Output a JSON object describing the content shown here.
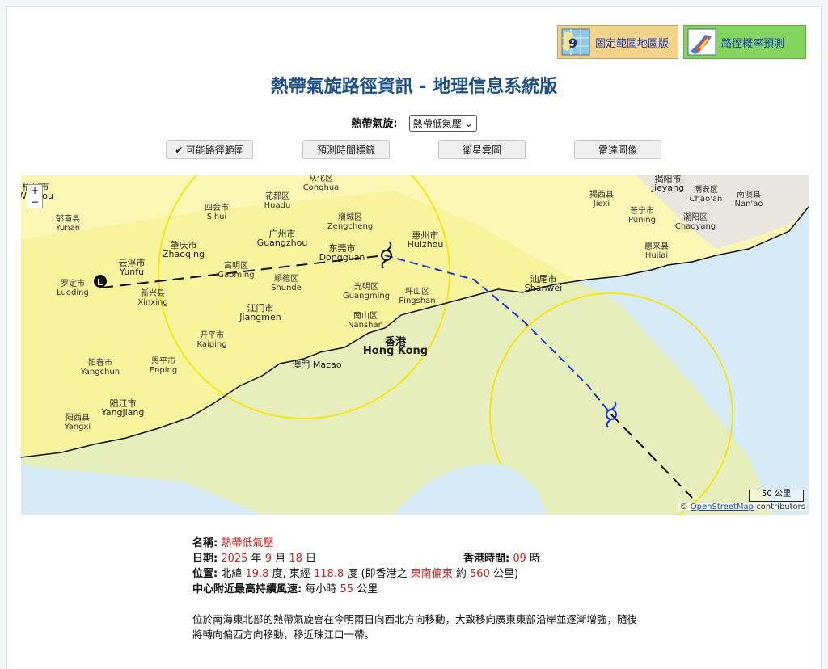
{
  "header": {
    "fixed_map_label": "固定範圍地圖版",
    "prob_label": "路徑概率預測",
    "title": "熱帶氣旋路徑資訊 - 地理信息系統版"
  },
  "selector": {
    "label": "熱帶氣旋:",
    "value": "熱帶低氣壓"
  },
  "controls": {
    "range": "✔ 可能路徑範圍",
    "time_labels": "預測時間標籤",
    "satellite": "衛星雲圖",
    "radar": "雷達圖像"
  },
  "map": {
    "attribution_symbol": "©",
    "attribution_link": "OpenStreetMap",
    "attribution_tail": "contributors",
    "scale": "50 公里",
    "zoom_in": "+",
    "zoom_out": "−",
    "places": [
      {
        "zh": "梧州市",
        "en": "Wuzhou"
      },
      {
        "zh": "从化区",
        "en": "Conghua"
      },
      {
        "zh": "揭阳市",
        "en": "Jieyang"
      },
      {
        "zh": "潮安区",
        "en": "Chao'an"
      },
      {
        "zh": "南澳县",
        "en": "Nan'ao"
      },
      {
        "zh": "四会市",
        "en": "Sihui"
      },
      {
        "zh": "花都区",
        "en": "Huadu"
      },
      {
        "zh": "揭西县",
        "en": "Jiexi"
      },
      {
        "zh": "郁南县",
        "en": "Yunan"
      },
      {
        "zh": "增城区",
        "en": "Zengcheng"
      },
      {
        "zh": "普宁市",
        "en": "Puning"
      },
      {
        "zh": "潮阳区",
        "en": "Chaoyang"
      },
      {
        "zh": "广州市",
        "en": "Guangzhou"
      },
      {
        "zh": "惠州市",
        "en": "Huizhou"
      },
      {
        "zh": "肇庆市",
        "en": "Zhaoqing"
      },
      {
        "zh": "东莞市",
        "en": "Dongguan"
      },
      {
        "zh": "惠来县",
        "en": "Huilai"
      },
      {
        "zh": "云浮市",
        "en": "Yunfu"
      },
      {
        "zh": "高明区",
        "en": "Gaoming"
      },
      {
        "zh": "顺德区",
        "en": "Shunde"
      },
      {
        "zh": "罗定市",
        "en": "Luoding"
      },
      {
        "zh": "新兴县",
        "en": "Xinxing"
      },
      {
        "zh": "光明区",
        "en": "Guangming"
      },
      {
        "zh": "坪山区",
        "en": "Pingshan"
      },
      {
        "zh": "汕尾市",
        "en": "Shanwei"
      },
      {
        "zh": "江门市",
        "en": "Jiangmen"
      },
      {
        "zh": "南山区",
        "en": "Nanshan"
      },
      {
        "zh": "开平市",
        "en": "Kaiping"
      },
      {
        "zh": "香港",
        "en": "Hong Kong"
      },
      {
        "zh": "阳春市",
        "en": "Yangchun"
      },
      {
        "zh": "恩平市",
        "en": "Enping"
      },
      {
        "zh": "澳門",
        "en": "Macao"
      },
      {
        "zh": "阳江市",
        "en": "Yangjiang"
      },
      {
        "zh": "阳西县",
        "en": "Yangxi"
      }
    ]
  },
  "info": {
    "name_label": "名稱:",
    "name_value": "熱帶低氣壓",
    "date_label": "日期:",
    "year": "2025",
    "year_unit": "年",
    "month": "9",
    "month_unit": "月",
    "day": "18",
    "day_unit": "日",
    "hktime_label": "香港時間:",
    "hour": "09",
    "hour_unit": "時",
    "pos_label": "位置:",
    "lat_prefix": "北緯",
    "lat": "19.8",
    "lat_unit": "度, 東經",
    "lon": "118.8",
    "lon_unit": "度 (即香港之",
    "direction": "東南偏東",
    "dist_prefix": "約",
    "distance": "560",
    "dist_unit": "公里)",
    "wind_label": "中心附近最高持續風速:",
    "wind_prefix": "每小時",
    "wind": "55",
    "wind_unit": "公里"
  },
  "description": "位於南海東北部的熱帶氣旋會在今明兩日向西北方向移動，大致移向廣東東部沿岸並逐漸增強，隨後將轉向偏西方向移動，移近珠江口一帶。",
  "colors": {
    "title": "#1b4f8a",
    "highlight": "#d2201e",
    "land": "#faf7b4",
    "sea": "#d6ebf6",
    "probability_area": "#f4f28a",
    "past_track": "#1a34d6"
  }
}
